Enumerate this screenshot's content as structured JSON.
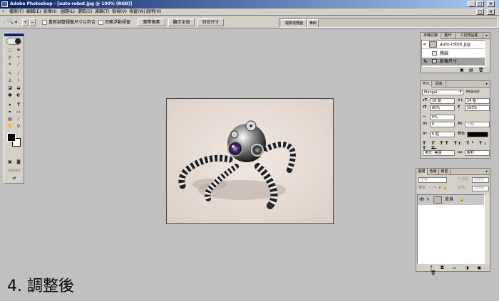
{
  "window": {
    "title": "Adobe Photoshop - [auto-robot.jpg @ 100% (RGB)]"
  },
  "menu": [
    "檔案(F)",
    "編輯(E)",
    "影像(I)",
    "圖層(L)",
    "選取(S)",
    "濾鏡(T)",
    "檢視(V)",
    "視窗(W)",
    "說明(H)"
  ],
  "options": {
    "resize_label": "重新調整視窗尺寸以符合",
    "ignore_palettes_label": "忽略浮動視窗",
    "actual_pixels": "實際像素",
    "fit_on_screen": "顯示全頁",
    "print_size": "列印尺寸"
  },
  "palette_well": {
    "tabs": [
      "檔案瀏覽器",
      "筆刷"
    ]
  },
  "history_panel": {
    "tabs": [
      "步驟記錄",
      "動作",
      "工具預設集"
    ],
    "snapshot": "auto-robot.jpg",
    "steps": [
      "開啟",
      "影像尺寸"
    ]
  },
  "character_panel": {
    "tabs": [
      "字元",
      "段落"
    ],
    "font": "Mangal",
    "style": "Regular",
    "size": "16 點",
    "leading": "24 點",
    "vscale": "80%",
    "hscale": "100%",
    "tracking": "0%",
    "kerning": "0",
    "kerning_auto": "公制",
    "baseline": "0 點",
    "color_label": "顏色:",
    "style_buttons": [
      "T",
      "T",
      "TT",
      "Tr",
      "T¹",
      "T₁",
      "T",
      "T"
    ],
    "language": "英文: 美國",
    "antialias_label": "aa",
    "antialias": "銳利"
  },
  "layers_panel": {
    "tabs": [
      "圖層",
      "色版",
      "路徑"
    ],
    "blend_mode": "正常",
    "opacity_label": "不透明:",
    "opacity": "100%",
    "lock_label": "鎖定:",
    "fill_label": "填滿:",
    "fill": "100%",
    "layers": [
      {
        "name": "背景"
      }
    ]
  },
  "caption": "4. 調整後"
}
